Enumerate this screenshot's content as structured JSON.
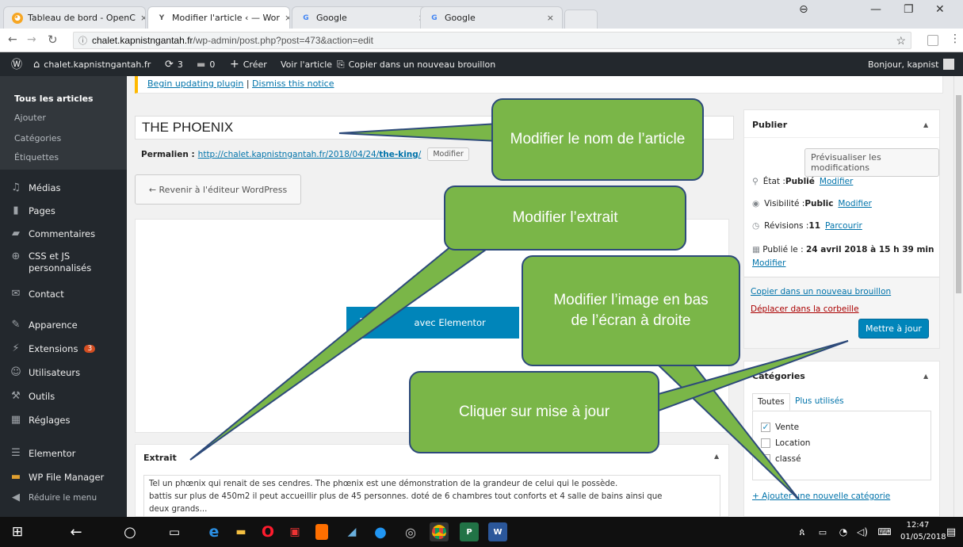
{
  "browser": {
    "tabs": [
      {
        "title": "Tableau de bord - OpenC",
        "favicon": "opencart-icon",
        "active": false
      },
      {
        "title": "Modifier l'article ‹ — Wor",
        "favicon": "wordpress-tab-icon",
        "active": true
      },
      {
        "title": "Google",
        "favicon": "google-icon",
        "active": false
      },
      {
        "title": "Google",
        "favicon": "google-icon",
        "active": false
      }
    ],
    "tab_close": "×",
    "url_host": "chalet.kapnistngantah.fr",
    "url_path": "/wp-admin/post.php?post=473&action=edit"
  },
  "adminbar": {
    "site": "chalet.kapnistngantah.fr",
    "updates": "3",
    "comments": "0",
    "new": "Créer",
    "view": "Voir l'article",
    "copy": "Copier dans un nouveau brouillon",
    "greeting": "Bonjour, kapnist"
  },
  "sidebar": {
    "submenu": [
      "Tous les articles",
      "Ajouter",
      "Catégories",
      "Étiquettes"
    ],
    "items": [
      {
        "label": "Médias",
        "icon": "media-icon"
      },
      {
        "label": "Pages",
        "icon": "pages-icon"
      },
      {
        "label": "Commentaires",
        "icon": "comments-icon"
      },
      {
        "label": "CSS et JS personnalisés",
        "icon": "plus-circle-icon"
      },
      {
        "label": "Contact",
        "icon": "mail-icon"
      },
      {
        "label": "Apparence",
        "icon": "brush-icon"
      },
      {
        "label": "Extensions",
        "icon": "plugin-icon",
        "badge": "3"
      },
      {
        "label": "Utilisateurs",
        "icon": "users-icon"
      },
      {
        "label": "Outils",
        "icon": "wrench-icon"
      },
      {
        "label": "Réglages",
        "icon": "settings-icon"
      },
      {
        "label": "Elementor",
        "icon": "elementor-icon"
      },
      {
        "label": "WP File Manager",
        "icon": "folder-icon"
      },
      {
        "label": "Réduire le menu",
        "icon": "collapse-icon"
      }
    ]
  },
  "notice": {
    "update_link": "Begin updating plugin",
    "separator": " | ",
    "dismiss_link": "Dismiss this notice"
  },
  "post": {
    "title": "THE PHOENIX",
    "permalink_label": "Permalien :",
    "permalink_base": "http://chalet.kapnistngantah.fr/2018/04/24/",
    "permalink_slug": "the-king",
    "permalink_end": "/",
    "permalink_edit": "Modifier",
    "back_button": "← Revenir à l'éditeur WordPress",
    "elementor_button": "avec Elementor"
  },
  "excerpt": {
    "heading": "Extrait",
    "line1": "Tel un phœnix qui renait de ses cendres. The phœnix est une démonstration de la grandeur de celui qui le possède.",
    "line2": "battis sur plus de 450m2 il peut accueillir plus de 45 personnes. doté de 6 chambres tout conforts et 4 salle de bains ainsi que",
    "line3": "deux grands..."
  },
  "publish": {
    "heading": "Publier",
    "preview_button": "Prévisualiser les modifications",
    "status_label": "État : ",
    "status_value": "Publié",
    "status_edit": "Modifier",
    "visibility_label": "Visibilité : ",
    "visibility_value": "Public",
    "visibility_edit": "Modifier",
    "revisions_label": "Révisions : ",
    "revisions_value": "11",
    "revisions_link": "Parcourir",
    "published_label": "Publié le : ",
    "published_value": "24 avril 2018 à 15 h 39 min",
    "published_edit": "Modifier",
    "copy_draft": "Copier dans un nouveau brouillon",
    "trash": "Déplacer dans la corbeille",
    "update_button": "Mettre à jour"
  },
  "categories": {
    "heading": "Catégories",
    "tab_all": "Toutes",
    "tab_most_used": "Plus utilisés",
    "items": [
      {
        "label": "Vente",
        "checked": true
      },
      {
        "label": "Location",
        "checked": false
      },
      {
        "label": "classé",
        "checked": false
      }
    ],
    "add_new": "+ Ajouter une nouvelle catégorie"
  },
  "callouts": {
    "rename": "Modifier le nom de l’article",
    "excerpt": "Modifier l’extrait",
    "image": "Modifier l’image en bas de l’écran à droite",
    "update": "Cliquer sur mise à jour"
  },
  "taskbar": {
    "time": "12:47",
    "date": "01/05/2018"
  },
  "colors": {
    "callout_fill": "#7ab648",
    "callout_border": "#2d4a7a",
    "wp_blue": "#0085ba",
    "wp_dark": "#23282d",
    "link": "#0073aa",
    "trash": "#a00"
  }
}
